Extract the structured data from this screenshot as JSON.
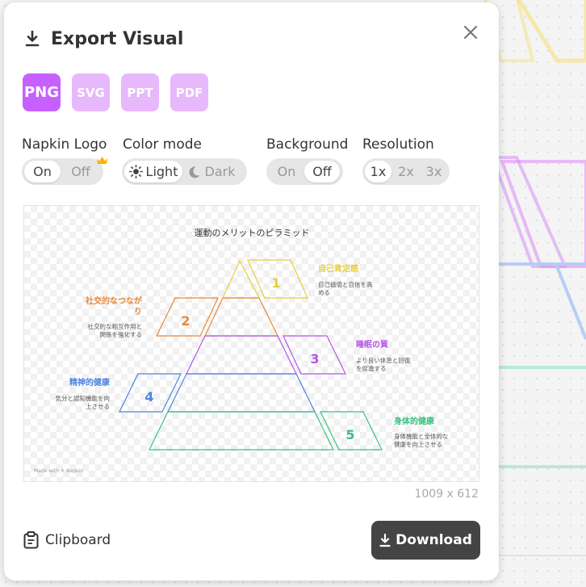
{
  "dialog": {
    "title": "Export Visual"
  },
  "formats": [
    {
      "label": "PNG",
      "active": true
    },
    {
      "label": "SVG",
      "active": false
    },
    {
      "label": "PPT",
      "active": false
    },
    {
      "label": "PDF",
      "active": false
    }
  ],
  "settings": {
    "logo": {
      "label": "Napkin Logo",
      "options": [
        "On",
        "Off"
      ],
      "selected": "On"
    },
    "color_mode": {
      "label": "Color mode",
      "options": [
        "Light",
        "Dark"
      ],
      "selected": "Light"
    },
    "background": {
      "label": "Background",
      "options": [
        "On",
        "Off"
      ],
      "selected": "Off"
    },
    "resolution": {
      "label": "Resolution",
      "options": [
        "1x",
        "2x",
        "3x"
      ],
      "selected": "1x"
    }
  },
  "preview": {
    "title": "運動のメリットのピラミッド",
    "watermark": "Made with ⚘ Napkin",
    "dimensions": "1009 x 612",
    "items": [
      {
        "number": "1",
        "heading": "自己肯定感",
        "desc": [
          "自己価値と自信を高",
          "める"
        ],
        "color": "#e8cf3c"
      },
      {
        "number": "2",
        "heading": "社交的なつなが",
        "heading2": "り",
        "desc": [
          "社交的な相互作用と",
          "関係を強化する"
        ],
        "color": "#e28a3b"
      },
      {
        "number": "3",
        "heading": "睡眠の質",
        "desc": [
          "より良い休息と回復",
          "を促進する"
        ],
        "color": "#b455e6"
      },
      {
        "number": "4",
        "heading": "精神的健康",
        "desc": [
          "気分と認知機能を向",
          "上させる"
        ],
        "color": "#4a85e0"
      },
      {
        "number": "5",
        "heading": "身体的健康",
        "desc": [
          "身体機能と全体的な",
          "健康を向上させる"
        ],
        "color": "#34c380"
      }
    ]
  },
  "actions": {
    "clipboard": "Clipboard",
    "download": "Download"
  },
  "colors": {
    "accent": "#c661ff",
    "accent_light": "#e7b8fb",
    "dark_button": "#444444"
  },
  "icons": [
    "download-icon",
    "close-icon",
    "crown-icon",
    "sun-icon",
    "moon-icon",
    "clipboard-icon"
  ]
}
